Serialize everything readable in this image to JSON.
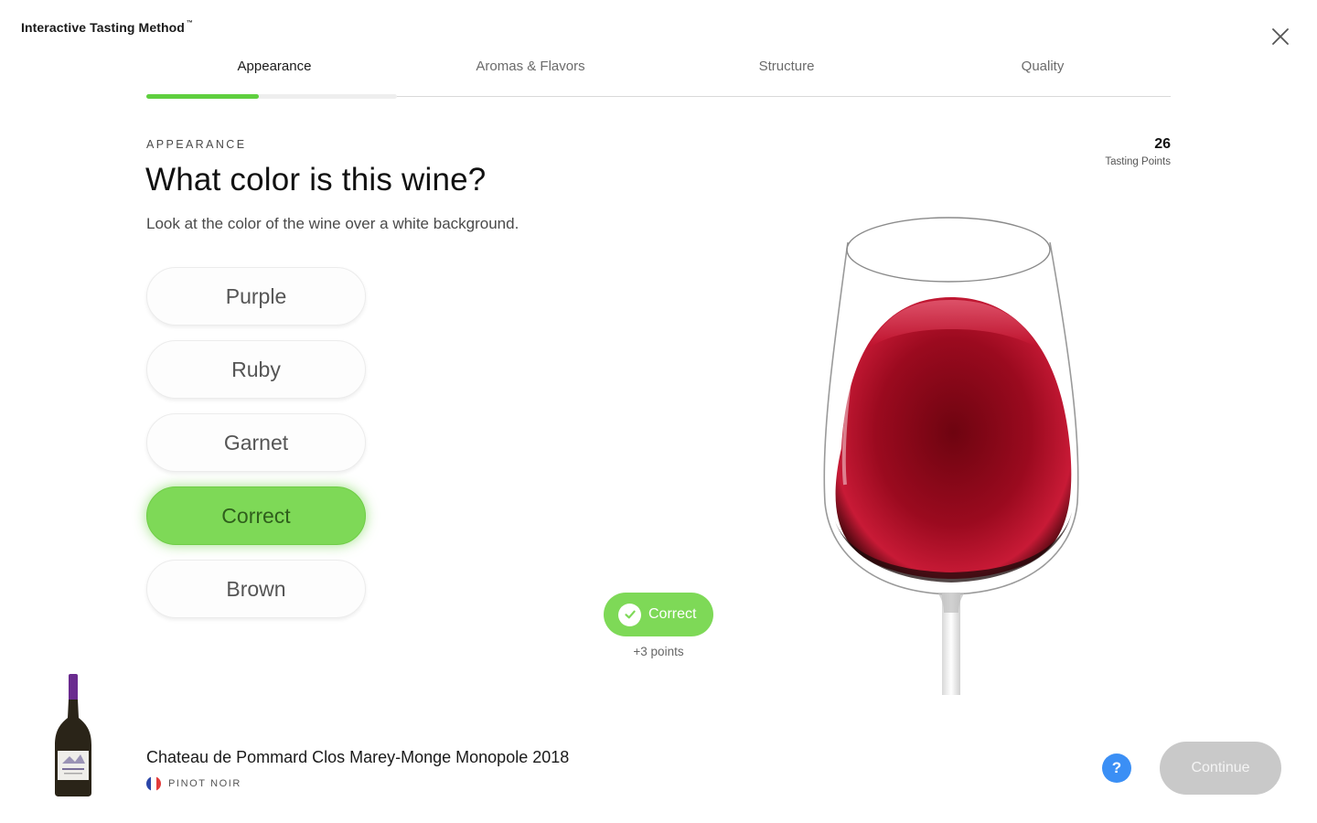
{
  "app": {
    "title": "Interactive Tasting Method",
    "trademark": "™"
  },
  "close_icon": "close-icon",
  "tabs": [
    {
      "label": "Appearance",
      "active": true
    },
    {
      "label": "Aromas & Flavors",
      "active": false
    },
    {
      "label": "Structure",
      "active": false
    },
    {
      "label": "Quality",
      "active": false
    }
  ],
  "progress": {
    "accent_color": "#5fcf3f"
  },
  "section": {
    "eyebrow": "APPEARANCE",
    "question": "What color is this wine?",
    "hint": "Look at the color of the wine over a white background."
  },
  "score": {
    "value": "26",
    "label": "Tasting Points"
  },
  "options": [
    {
      "label": "Purple",
      "state": "default"
    },
    {
      "label": "Ruby",
      "state": "default"
    },
    {
      "label": "Garnet",
      "state": "default"
    },
    {
      "label": "Correct",
      "state": "correct"
    },
    {
      "label": "Brown",
      "state": "default"
    }
  ],
  "result": {
    "label": "Correct",
    "points": "+3 points",
    "icon": "check-icon",
    "color": "#7ed957"
  },
  "wine": {
    "name": "Chateau de Pommard Clos Marey-Monge Monopole 2018",
    "varietal": "PINOT NOIR",
    "country_flag": "france-flag-icon"
  },
  "footer": {
    "help_label": "?",
    "continue_label": "Continue"
  }
}
